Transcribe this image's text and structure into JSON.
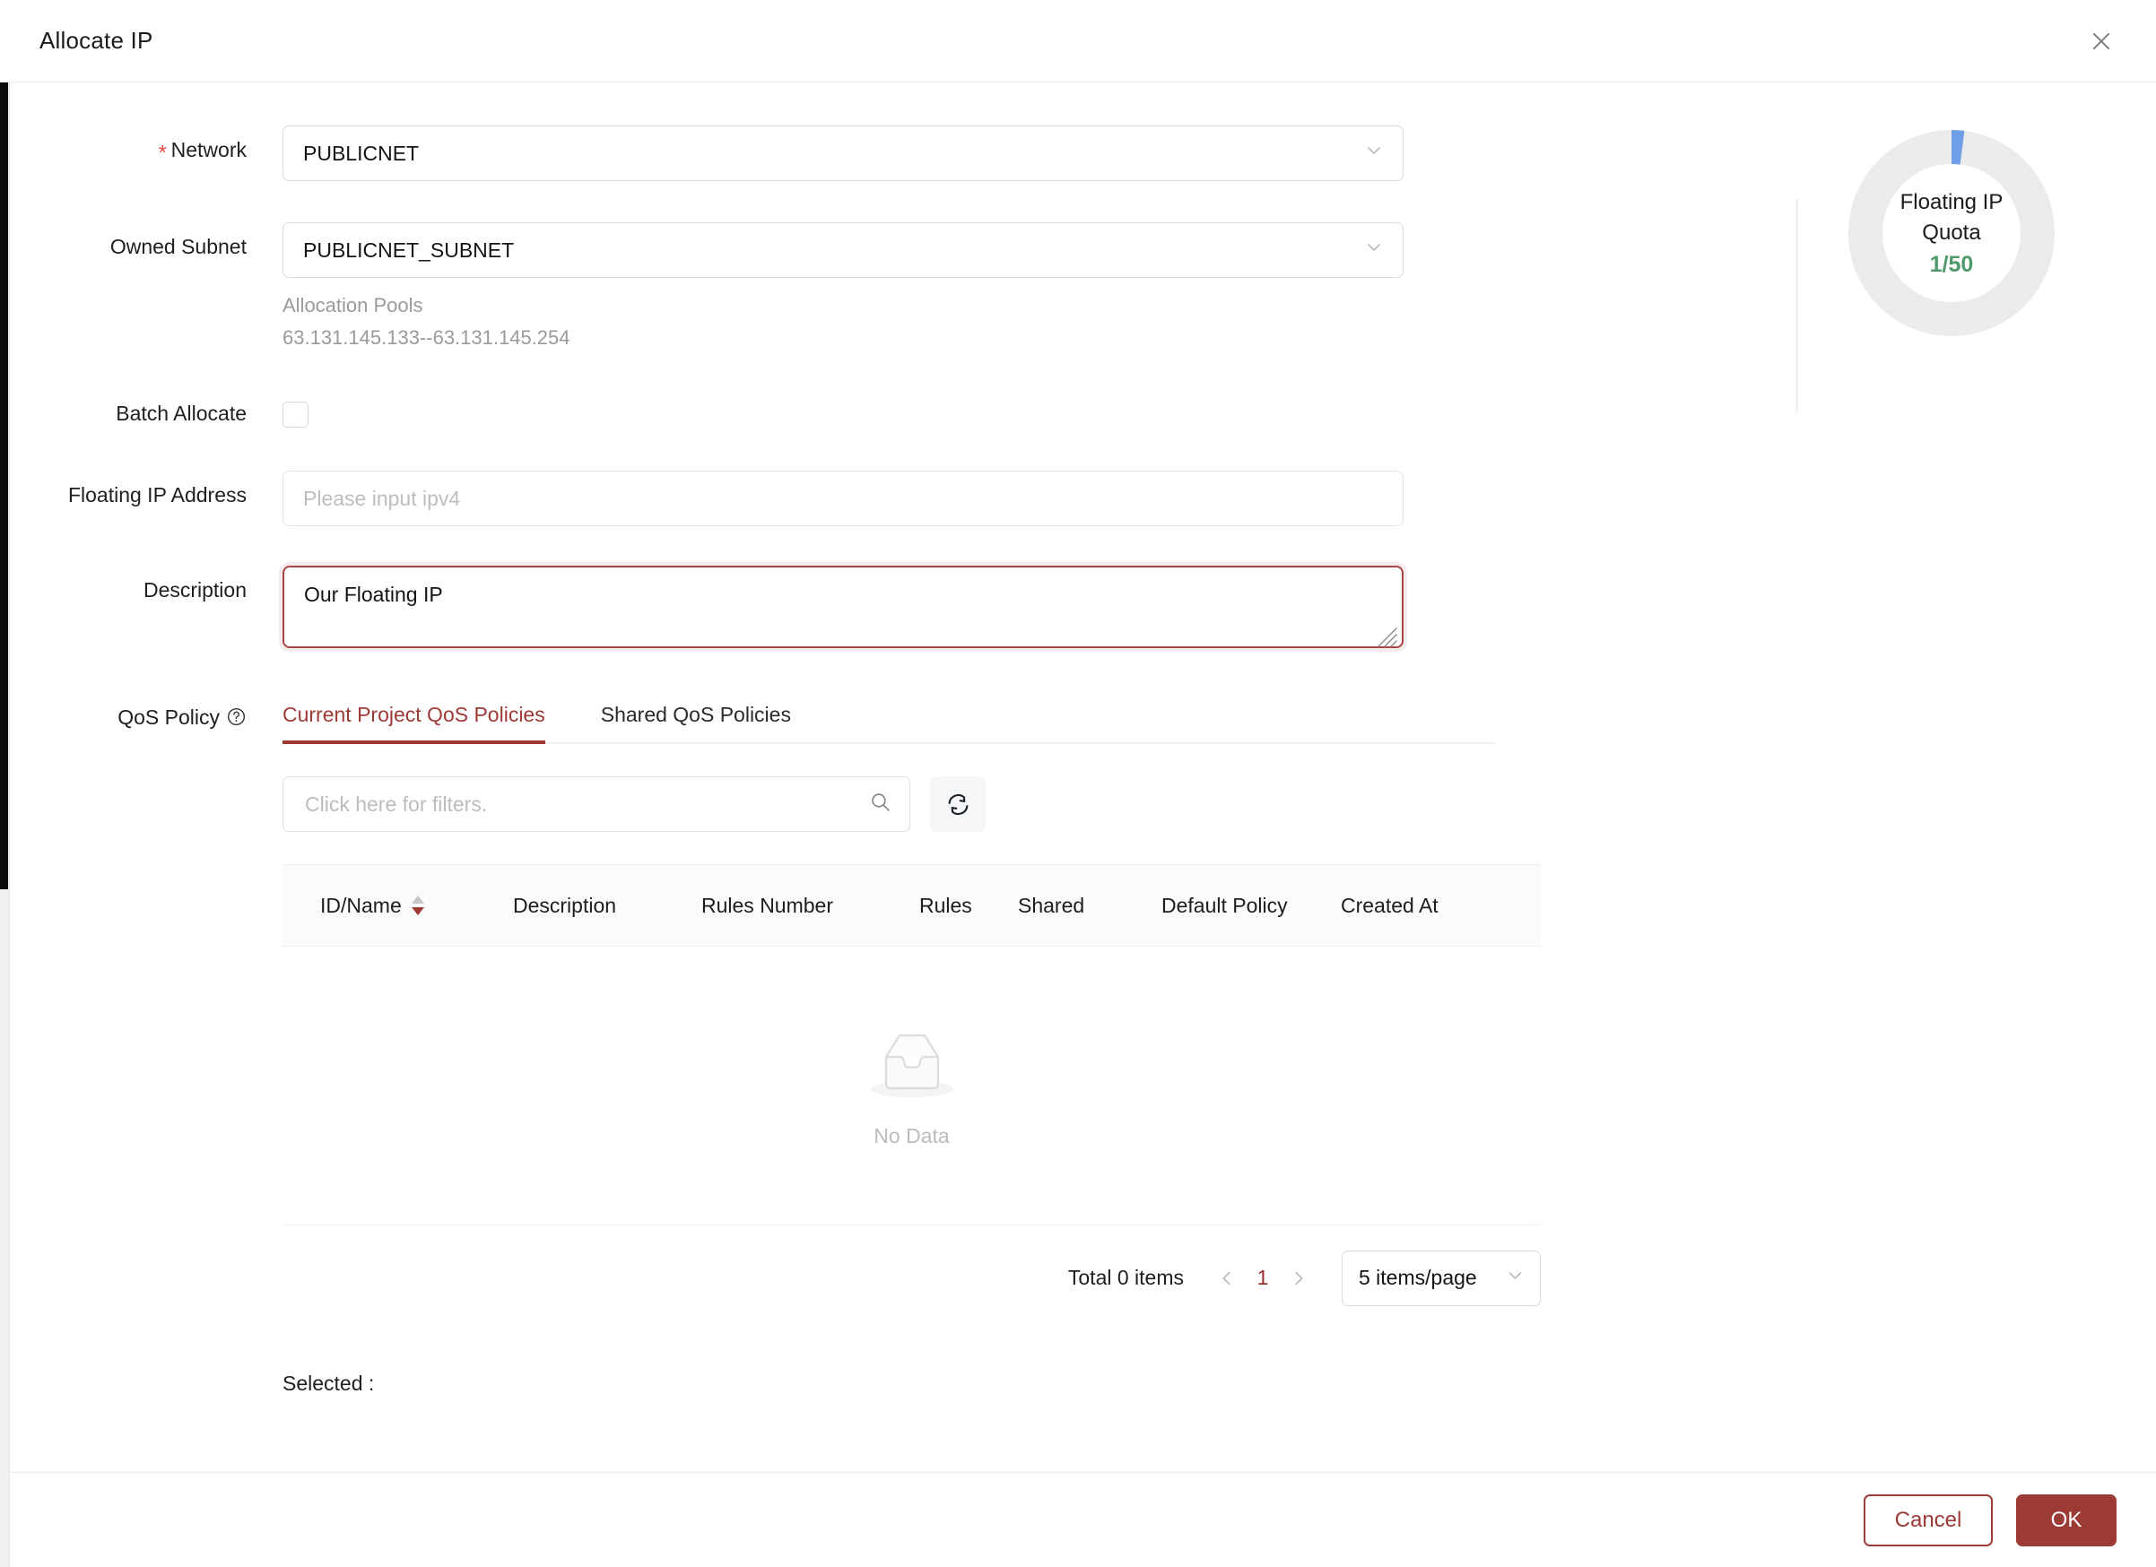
{
  "dialog": {
    "title": "Allocate IP",
    "close_icon": "close-icon"
  },
  "form": {
    "network": {
      "label": "Network",
      "required": true,
      "value": "PUBLICNET",
      "chevron_icon": "chevron-down-icon"
    },
    "owned_subnet": {
      "label": "Owned Subnet",
      "value": "PUBLICNET_SUBNET",
      "chevron_icon": "chevron-down-icon",
      "hint_title": "Allocation Pools",
      "hint_range": "63.131.145.133--63.131.145.254"
    },
    "batch_allocate": {
      "label": "Batch Allocate",
      "checked": false
    },
    "floating_ip_address": {
      "label": "Floating IP Address",
      "value": "",
      "placeholder": "Please input ipv4"
    },
    "description": {
      "label": "Description",
      "value": "Our Floating IP",
      "error": true,
      "resize_handle_icon": "resize-grip-icon"
    },
    "qos_policy": {
      "label": "QoS Policy",
      "help_icon": "question-circle-icon"
    }
  },
  "tabs": [
    {
      "label": "Current Project QoS Policies",
      "active": true
    },
    {
      "label": "Shared QoS Policies",
      "active": false
    }
  ],
  "filter": {
    "placeholder": "Click here for filters.",
    "value": "",
    "search_icon": "search-icon",
    "refresh_icon": "refresh-icon"
  },
  "table": {
    "columns": [
      {
        "label": "ID/Name",
        "sortable": true,
        "sort_icon": "sort-arrows-icon"
      },
      {
        "label": "Description",
        "sortable": false
      },
      {
        "label": "Rules Number",
        "sortable": false
      },
      {
        "label": "Rules",
        "sortable": false
      },
      {
        "label": "Shared",
        "sortable": false
      },
      {
        "label": "Default Policy",
        "sortable": false
      },
      {
        "label": "Created At",
        "sortable": false
      }
    ],
    "rows": [],
    "empty_text": "No Data",
    "empty_icon": "empty-inbox-icon"
  },
  "pagination": {
    "total_text": "Total 0 items",
    "prev_icon": "chevron-left-icon",
    "next_icon": "chevron-right-icon",
    "current_page": "1",
    "page_size_label": "5 items/page",
    "page_size_chevron_icon": "chevron-down-icon"
  },
  "selected": {
    "label": "Selected :",
    "value": ""
  },
  "quota": {
    "title_line1": "Floating IP",
    "title_line2": "Quota",
    "value_text": "1/50",
    "used": 1,
    "total": 50,
    "used_color": "#6f9fe8",
    "track_color": "#ebebeb",
    "value_color": "#4e9a6a"
  },
  "footer": {
    "cancel_label": "Cancel",
    "ok_label": "OK"
  },
  "colors": {
    "accent": "#9c3a36",
    "error": "#a94442",
    "required_star": "#e8433c"
  }
}
